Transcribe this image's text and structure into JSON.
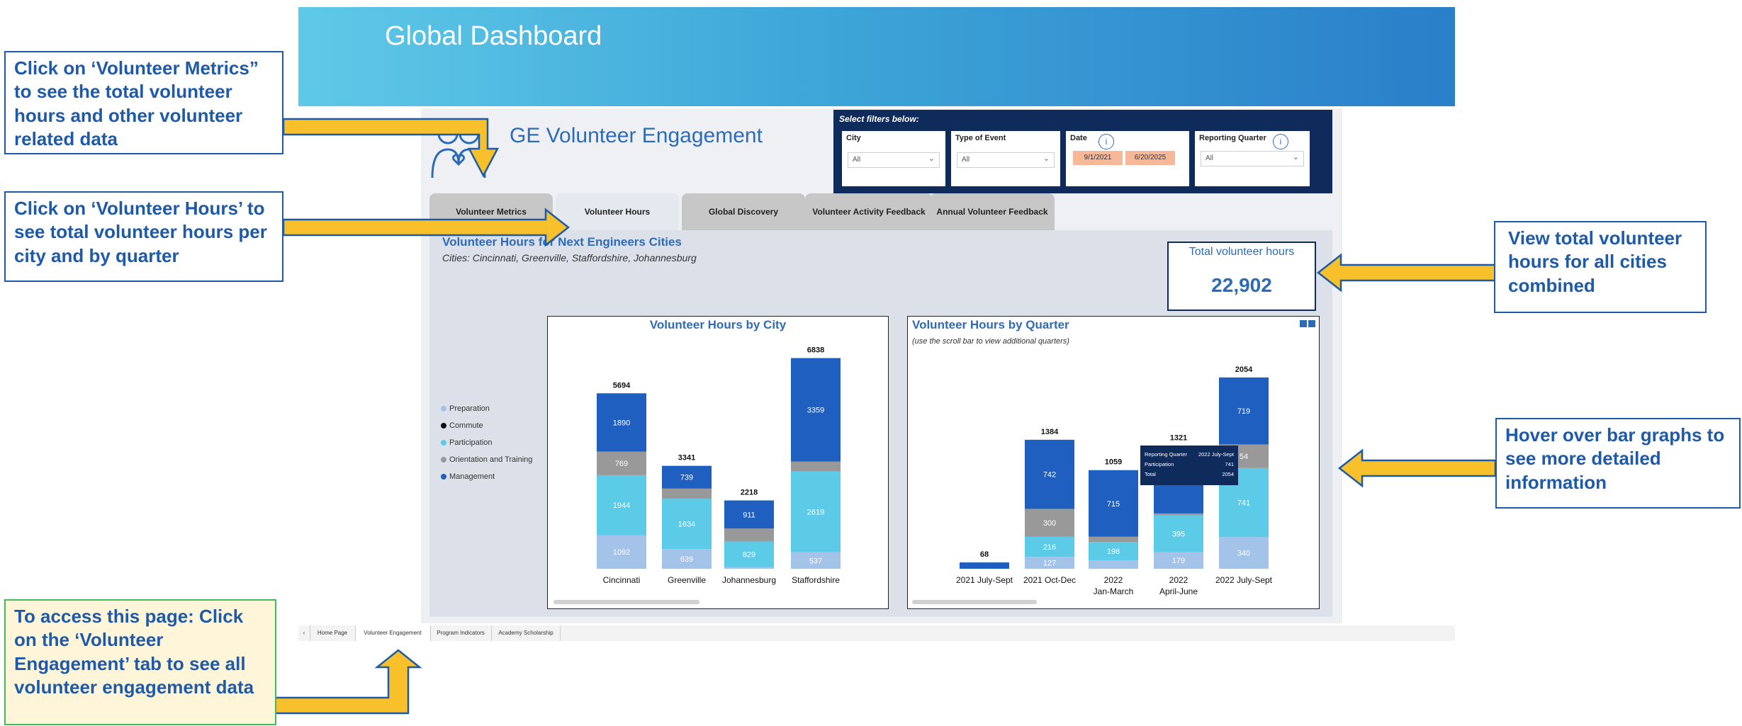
{
  "header": {
    "title": "Global Dashboard"
  },
  "engagement": {
    "title": "GE Volunteer Engagement"
  },
  "filters": {
    "label": "Select filters below:",
    "city": {
      "label": "City",
      "value": "All"
    },
    "event_type": {
      "label": "Type of Event",
      "value": "All"
    },
    "date": {
      "label": "Date",
      "start": "9/1/2021",
      "end": "6/20/2025",
      "info": "i"
    },
    "quarter": {
      "label": "Reporting Quarter",
      "value": "All",
      "info": "i"
    }
  },
  "tabs": [
    "Volunteer Metrics",
    "Volunteer Hours",
    "Global Discovery",
    "Volunteer Activity Feedback",
    "Annual Volunteer Feedback"
  ],
  "active_tab": "Volunteer Hours",
  "section": {
    "title": "Volunteer Hours for Next Engineers Cities",
    "subtitle": "Cities: Cincinnati, Greenville, Staffordshire, Johannesburg"
  },
  "total": {
    "label": "Total volunteer hours",
    "value": "22,902"
  },
  "legend": [
    {
      "name": "Preparation",
      "color": "#a4c3e8"
    },
    {
      "name": "Commute",
      "color": "#111111"
    },
    {
      "name": "Participation",
      "color": "#5ccbe8"
    },
    {
      "name": "Orientation and Training",
      "color": "#999999"
    },
    {
      "name": "Management",
      "color": "#1f5fbf"
    }
  ],
  "chart_data": [
    {
      "type": "bar",
      "stacked": true,
      "title": "Volunteer Hours by City",
      "categories": [
        "Cincinnati",
        "Greenville",
        "Johannesburg",
        "Staffordshire"
      ],
      "totals": [
        5694,
        3341,
        2218,
        6838
      ],
      "series": [
        {
          "name": "Preparation",
          "values": [
            1092,
            639,
            57,
            537
          ]
        },
        {
          "name": "Participation",
          "values": [
            1944,
            1634,
            829,
            2619
          ]
        },
        {
          "name": "Orientation and Training",
          "values": [
            769,
            329,
            421,
            323
          ]
        },
        {
          "name": "Management",
          "values": [
            1890,
            739,
            911,
            3359
          ]
        }
      ],
      "labels": [
        [
          "1092",
          "639",
          "",
          "537"
        ],
        [
          "1944",
          "1634",
          "829",
          "2619"
        ],
        [
          "769",
          "",
          "",
          ""
        ],
        [
          "1890",
          "739",
          "911",
          "3359"
        ]
      ]
    },
    {
      "type": "bar",
      "stacked": true,
      "title": "Volunteer Hours by Quarter",
      "subtitle": "(use the scroll bar to view additional quarters)",
      "categories": [
        "2021 July-Sept",
        "2021 Oct-Dec",
        "2022\nJan-March",
        "2022\nApril-June",
        "2022 July-Sept"
      ],
      "totals": [
        68,
        1384,
        1059,
        1321,
        2054
      ],
      "series": [
        {
          "name": "Preparation",
          "values": [
            0,
            127,
            90,
            179,
            340
          ]
        },
        {
          "name": "Participation",
          "values": [
            0,
            216,
            198,
            395,
            741
          ]
        },
        {
          "name": "Orientation and Training",
          "values": [
            0,
            300,
            56,
            20,
            254
          ]
        },
        {
          "name": "Management",
          "values": [
            68,
            742,
            715,
            727,
            719
          ]
        }
      ],
      "labels": [
        [
          "",
          "127",
          "",
          "179",
          "340"
        ],
        [
          "",
          "216",
          "198",
          "395",
          "741"
        ],
        [
          "",
          "300",
          "",
          "",
          "54"
        ],
        [
          "",
          "742",
          "715",
          "",
          "719"
        ]
      ],
      "tooltip": {
        "rows": [
          [
            "Reporting Quarter",
            "2022 July-Sept"
          ],
          [
            "Participation",
            "741"
          ],
          [
            "Total",
            "2054"
          ]
        ]
      }
    }
  ],
  "footer_tabs": [
    "Home Page",
    "Volunteer Engagement",
    "Program Indicators",
    "Academy Scholarship"
  ],
  "callouts": {
    "metrics": "Click on ‘Volunteer Metrics” to see the total volunteer hours and other volunteer related data",
    "hours": "Click on ‘Volunteer Hours’ to see total volunteer hours per city and by quarter",
    "total": "View total volunteer hours for all cities combined",
    "hover": "Hover over bar graphs to see more detailed information",
    "access": "To access this page: Click on the ‘Volunteer Engagement’ tab to see all volunteer engagement data"
  }
}
